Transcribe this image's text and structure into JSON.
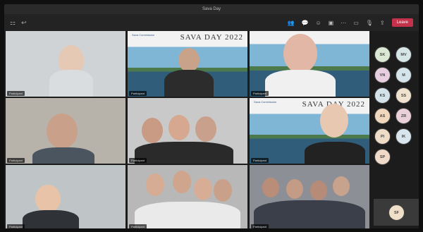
{
  "window": {
    "title": "Sava Day"
  },
  "toolbar": {
    "left_icons": [
      "grid-icon",
      "back-icon"
    ],
    "buttons": [
      {
        "name": "people-icon",
        "glyph": "👥"
      },
      {
        "name": "chat-icon",
        "glyph": "💬"
      },
      {
        "name": "reactions-icon",
        "glyph": "☺"
      },
      {
        "name": "rooms-icon",
        "glyph": "▣"
      },
      {
        "name": "more-icon",
        "glyph": "⋯"
      },
      {
        "name": "camera-icon",
        "glyph": "▭"
      },
      {
        "name": "mic-icon",
        "glyph": "🎙"
      },
      {
        "name": "share-icon",
        "glyph": "⇪"
      }
    ],
    "leave_label": "Leave"
  },
  "tiles": [
    {
      "label": "Participant",
      "bg": "#cfd3d6"
    },
    {
      "label": "Participant",
      "bg": "#3d6f8f",
      "banner": "SAVA DAY 2022",
      "logo": "Sava Commission"
    },
    {
      "label": "Participant",
      "bg": "#3d6f8f"
    },
    {
      "label": "Participant",
      "bg": "#b7b3ab"
    },
    {
      "label": "Participant",
      "bg": "#c9c9c9"
    },
    {
      "label": "Participant",
      "bg": "#3d6f8f",
      "banner": "SAVA DAY 2022",
      "logo": "Sava Commission"
    },
    {
      "label": "Participant",
      "bg": "#bfc4c6"
    },
    {
      "label": "Participant",
      "bg": "#b8b8b8"
    },
    {
      "label": "Participant",
      "bg": "#8c8f95"
    }
  ],
  "sidebar": {
    "avatars": [
      {
        "initials": "SK",
        "color": "#dbe8d4"
      },
      {
        "initials": "MV",
        "color": "#d6e6e7"
      },
      {
        "initials": "VN",
        "color": "#e8cfe0"
      },
      {
        "initials": "M",
        "color": "#d5e3ea"
      },
      {
        "initials": "KS",
        "color": "#d4e3e9"
      },
      {
        "initials": "SS",
        "color": "#efe2cf"
      },
      {
        "initials": "AS",
        "color": "#efd8bd"
      },
      {
        "initials": "ZR",
        "color": "#ead1d9"
      },
      {
        "initials": "PI",
        "color": "#efdcc6"
      },
      {
        "initials": "IK",
        "color": "#d8e5ec"
      },
      {
        "initials": "SP",
        "color": "#efd9c9"
      }
    ],
    "self": {
      "initials": "SF",
      "color": "#efdfc8"
    }
  }
}
